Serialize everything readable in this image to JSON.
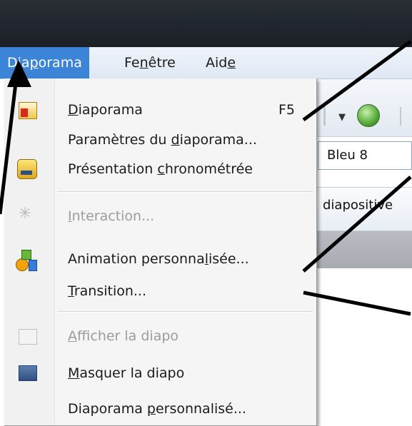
{
  "menubar": {
    "items": [
      {
        "pre": "Dia",
        "key": "p",
        "post": "orama"
      },
      {
        "pre": "Fe",
        "key": "n",
        "post": "être"
      },
      {
        "pre": "Aid",
        "key": "e",
        "post": ""
      }
    ]
  },
  "toolbar": {
    "combo_value": "Bleu 8",
    "tab_label": "diapositive"
  },
  "dropdown": {
    "items": [
      {
        "pre": "",
        "key": "D",
        "post": "iaporama",
        "shortcut": "F5",
        "icon": "slideshow-icon",
        "disabled": false
      },
      {
        "pre": "Paramètres du ",
        "key": "d",
        "post": "iaporama...",
        "icon": "",
        "disabled": false
      },
      {
        "pre": "Présentation ",
        "key": "c",
        "post": "hronométrée",
        "icon": "timer-icon",
        "disabled": false
      },
      {
        "pre": "",
        "key": "I",
        "post": "nteraction...",
        "icon": "interaction-icon",
        "disabled": true
      },
      {
        "pre": "Animation personna",
        "key": "l",
        "post": "isée...",
        "icon": "animation-icon",
        "disabled": false
      },
      {
        "pre": "",
        "key": "T",
        "post": "ransition...",
        "icon": "",
        "disabled": false
      },
      {
        "pre": "",
        "key": "A",
        "post": "fficher la diapo",
        "icon": "show-slide-icon",
        "disabled": true
      },
      {
        "pre": "",
        "key": "M",
        "post": "asquer la diapo",
        "icon": "hide-slide-icon",
        "disabled": false
      },
      {
        "pre": "Diaporama ",
        "key": "p",
        "post": "ersonnalisé...",
        "icon": "",
        "disabled": false
      }
    ]
  },
  "colors": {
    "menu_highlight": "#3c85d6",
    "title_bar": "#222830",
    "disabled_text": "#9c9c9c"
  }
}
